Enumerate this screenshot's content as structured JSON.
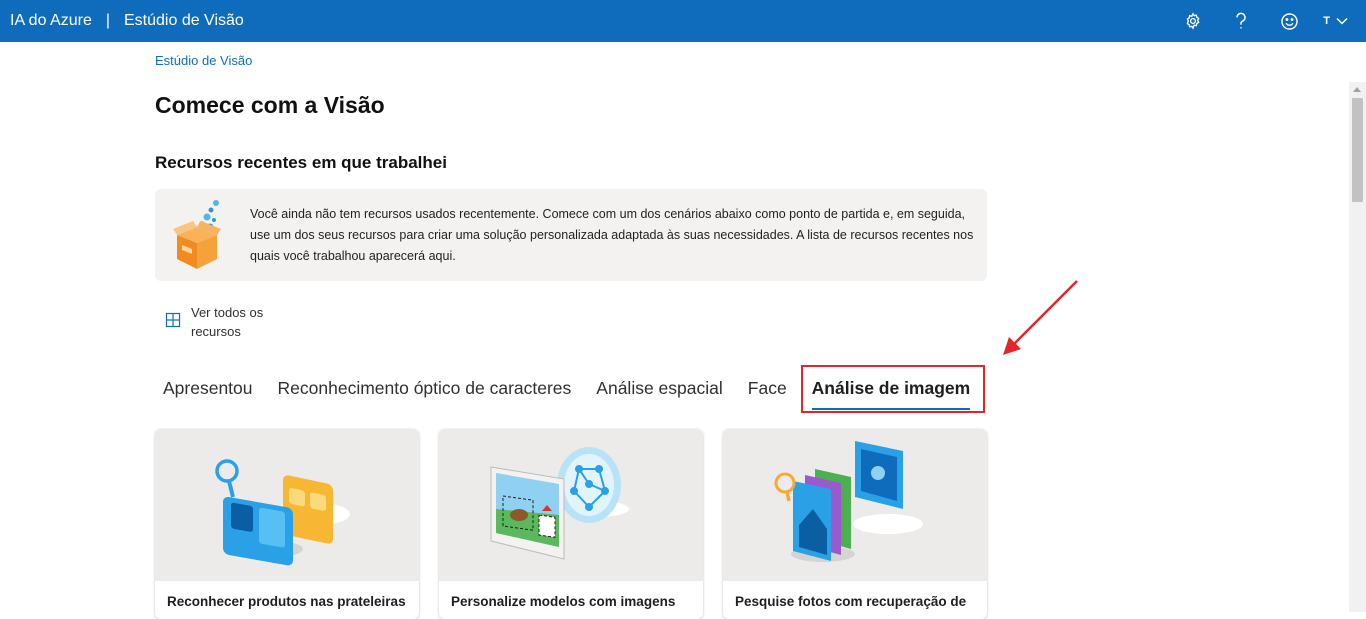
{
  "header": {
    "brand": "IA do Azure",
    "separator": "|",
    "app": "Estúdio de Visão",
    "icons": [
      "gear-icon",
      "help-icon",
      "feedback-smiley-icon"
    ],
    "account_initial": "T"
  },
  "breadcrumb": "Estúdio de Visão",
  "page_title": "Comece com a Visão",
  "recent": {
    "title": "Recursos recentes em que trabalhei",
    "empty_message": "Você ainda não tem recursos usados recentemente. Comece com um dos cenários abaixo como ponto de partida e, em seguida, use um dos seus recursos para criar uma solução personalizada adaptada às suas necessidades. A lista de recursos recentes nos quais você trabalhou aparecerá aqui.",
    "view_all_label": "Ver todos os recursos"
  },
  "tabs": [
    {
      "label": "Apresentou"
    },
    {
      "label": "Reconhecimento óptico de caracteres"
    },
    {
      "label": "Análise espacial"
    },
    {
      "label": "Face"
    },
    {
      "label": "Análise de imagem",
      "selected": true
    }
  ],
  "cards": [
    {
      "title": "Reconhecer produtos nas prateleiras"
    },
    {
      "title": "Personalize modelos com imagens"
    },
    {
      "title": "Pesquise fotos com recuperação de"
    }
  ],
  "colors": {
    "header": "#0f6cbd",
    "annotation_red": "#e3262b",
    "card_art_bg": "#ecebea"
  }
}
